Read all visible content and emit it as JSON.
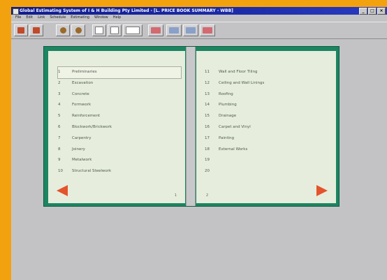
{
  "window": {
    "title": "Global Estimating System of I & H Building Pty Limited - [L. PRICE BOOK SUMMARY - WBB]",
    "controls": [
      "_",
      "□",
      "×"
    ]
  },
  "menu": [
    "File",
    "Edit",
    "Link",
    "Schedule",
    "Estimating",
    "Window",
    "Help"
  ],
  "toolbar": {
    "buttons": [
      {
        "name": "open-icon",
        "color": "#c04a2a"
      },
      {
        "name": "print-icon",
        "color": "#c04a2a"
      },
      {
        "name": "record-icon",
        "color": "#9a6a2a"
      },
      {
        "name": "record-alt-icon",
        "color": "#9a6a2a"
      },
      {
        "name": "paste-icon",
        "color": "#ffffff"
      },
      {
        "name": "document-icon",
        "color": "#ffffff"
      },
      {
        "name": "tools-icon",
        "color": "#ffffff"
      },
      {
        "name": "chart-icon",
        "color": "#d26a70"
      },
      {
        "name": "grid-icon",
        "color": "#8aa0c8"
      },
      {
        "name": "calc-icon",
        "color": "#8aa0c8"
      },
      {
        "name": "sheet-icon",
        "color": "#d26a70"
      }
    ]
  },
  "book": {
    "left_items": [
      {
        "num": "1",
        "label": "Preliminaries"
      },
      {
        "num": "2",
        "label": "Excavation"
      },
      {
        "num": "3",
        "label": "Concrete"
      },
      {
        "num": "4",
        "label": "Formwork"
      },
      {
        "num": "5",
        "label": "Reinforcement"
      },
      {
        "num": "6",
        "label": "Blockwork/Brickwork"
      },
      {
        "num": "7",
        "label": "Carpentry"
      },
      {
        "num": "8",
        "label": "Joinery"
      },
      {
        "num": "9",
        "label": "Metalwork"
      },
      {
        "num": "10",
        "label": "Structural Steelwork"
      }
    ],
    "right_items": [
      {
        "num": "11",
        "label": "Wall and Floor Tiling"
      },
      {
        "num": "12",
        "label": "Ceiling and Wall Linings"
      },
      {
        "num": "13",
        "label": "Roofing"
      },
      {
        "num": "14",
        "label": "Plumbing"
      },
      {
        "num": "15",
        "label": "Drainage"
      },
      {
        "num": "16",
        "label": "Carpet and Vinyl"
      },
      {
        "num": "17",
        "label": "Painting"
      },
      {
        "num": "18",
        "label": "External Works"
      },
      {
        "num": "19",
        "label": ""
      },
      {
        "num": "20",
        "label": ""
      }
    ],
    "left_page_number": "1",
    "right_page_number": "2"
  },
  "colors": {
    "book_border": "#1c8561",
    "page": "#e6eddc",
    "arrow": "#e4532c",
    "titlebar": "#101b8c",
    "desktop": "#f3a20f"
  }
}
